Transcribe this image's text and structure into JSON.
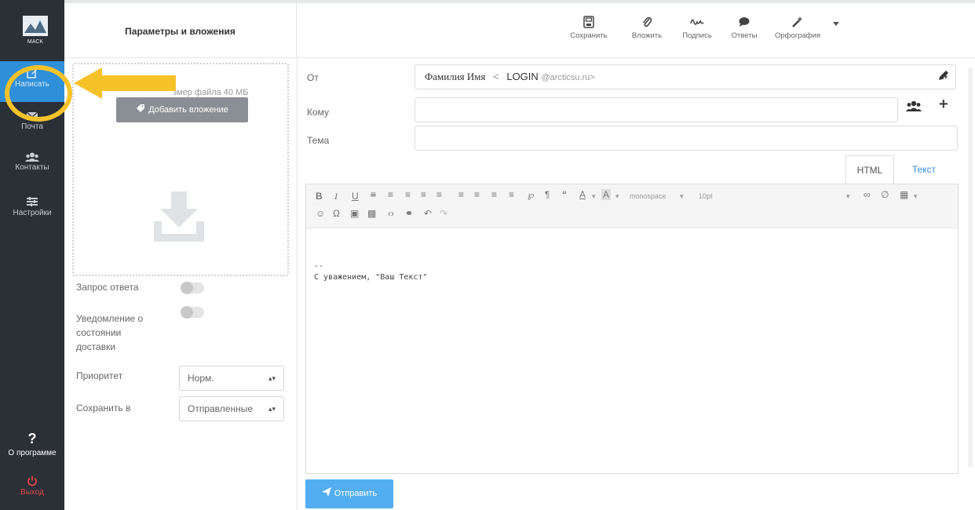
{
  "sidebar": {
    "logo_text": "MACK",
    "items": [
      {
        "id": "compose",
        "label": "Написать",
        "icon": "compose-icon"
      },
      {
        "id": "mail",
        "label": "Почта",
        "icon": "mail-icon"
      },
      {
        "id": "contacts",
        "label": "Контакты",
        "icon": "contacts-icon"
      },
      {
        "id": "settings",
        "label": "Настройки",
        "icon": "settings-icon"
      },
      {
        "id": "about",
        "label": "О программе",
        "icon": "question-icon"
      },
      {
        "id": "logout",
        "label": "Выход",
        "icon": "power-icon"
      }
    ],
    "about_glyph": "?"
  },
  "left_panel": {
    "title": "Параметры и вложения",
    "max_size_text": "змер файла 40 МБ",
    "add_attachment_label": "Добавить вложение",
    "options": {
      "read_receipt_label": "Запрос ответа",
      "delivery_status_label_lines": [
        "Уведомление о",
        "состоянии",
        "доставки"
      ],
      "priority_label": "Приоритет",
      "priority_value": "Норм.",
      "save_in_label": "Сохранить в",
      "save_in_value": "Отправленные"
    }
  },
  "toolbar": {
    "save_label": "Сохранить",
    "attach_label": "Вложить",
    "signature_label": "Подпись",
    "replies_label": "Ответы",
    "spelling_label": "Орфография"
  },
  "compose": {
    "from_label": "От",
    "from_name": "Фамилия Имя",
    "from_sep": "<",
    "from_login": "LOGIN",
    "from_domain": "@arcticsu.ru>",
    "to_label": "Кому",
    "subject_label": "Тема",
    "tab_html": "HTML",
    "tab_text": "Текст",
    "editor_font_select": "monospace",
    "editor_size_select": "10pt",
    "body_signature_dash": "--",
    "body_signature_text": "С уважением, \"Ваш Текст\"",
    "send_label": "Отправить"
  },
  "colors": {
    "accent": "#2f8fd8",
    "send_button": "#52aef0",
    "callout": "#f6c22a",
    "sidebar_bg": "#2b2f36",
    "logout": "#e04848"
  }
}
